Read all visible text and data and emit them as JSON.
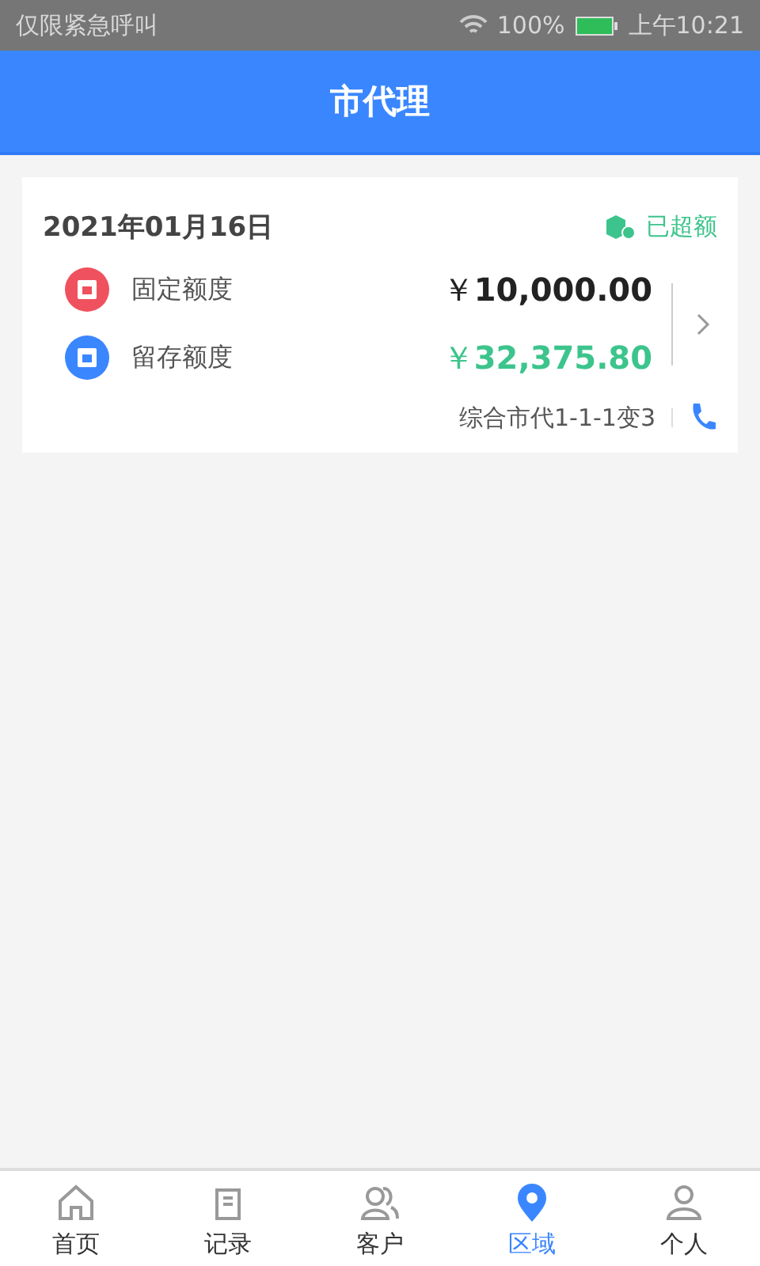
{
  "status_bar": {
    "carrier": "仅限紧急呼叫",
    "battery": "100%",
    "time": "上午10:21"
  },
  "header": {
    "title": "市代理"
  },
  "card": {
    "date": "2021年01月16日",
    "status": "已超额",
    "quotas": [
      {
        "kind": "fixed",
        "label": "固定额度",
        "amount": "10,000.00",
        "currency": "￥",
        "color": "#222222"
      },
      {
        "kind": "retained",
        "label": "留存额度",
        "amount": "32,375.80",
        "currency": "￥",
        "color": "#3cc48c"
      }
    ],
    "agent": "综合市代1-1-1变3"
  },
  "tabs": [
    {
      "kind": "home",
      "label": "首页",
      "selected": false
    },
    {
      "kind": "records",
      "label": "记录",
      "selected": false
    },
    {
      "kind": "customers",
      "label": "客户",
      "selected": false
    },
    {
      "kind": "region",
      "label": "区域",
      "selected": true
    },
    {
      "kind": "personal",
      "label": "个人",
      "selected": false
    }
  ]
}
